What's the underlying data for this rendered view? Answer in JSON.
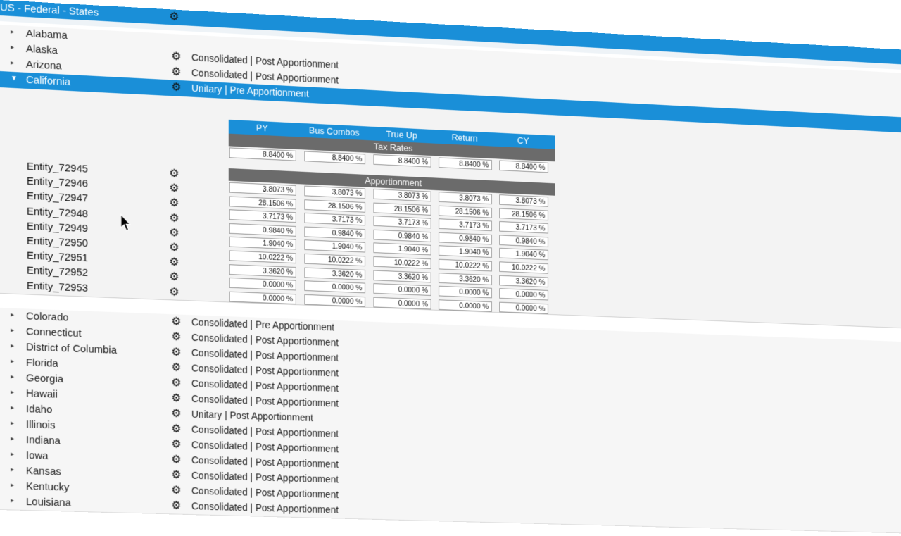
{
  "header": {
    "title": "US - Federal - States"
  },
  "states_before": [
    {
      "name": "Alabama",
      "mode": ""
    },
    {
      "name": "Alaska",
      "mode": "Consolidated | Post Apportionment"
    },
    {
      "name": "Arizona",
      "mode": "Consolidated | Post Apportionment"
    }
  ],
  "selected_state": {
    "name": "California",
    "mode": "Unitary | Pre Apportionment",
    "extra_mode": "Unitary | Post Apportionment"
  },
  "columns": [
    "PY",
    "Bus Combos",
    "True Up",
    "Return",
    "CY"
  ],
  "sections": {
    "tax_rates": "Tax Rates",
    "apportionment": "Apportionment"
  },
  "tax_rates": [
    "8.8400 %",
    "8.8400 %",
    "8.8400 %",
    "8.8400 %",
    "8.8400 %"
  ],
  "entities": [
    {
      "name": "Entity_72945",
      "values": []
    },
    {
      "name": "Entity_72946",
      "values": [
        "3.8073 %",
        "3.8073 %",
        "3.8073 %",
        "3.8073 %",
        "3.8073 %"
      ]
    },
    {
      "name": "Entity_72947",
      "values": [
        "28.1506 %",
        "28.1506 %",
        "28.1506 %",
        "28.1506 %",
        "28.1506 %"
      ]
    },
    {
      "name": "Entity_72948",
      "values": [
        "3.7173 %",
        "3.7173 %",
        "3.7173 %",
        "3.7173 %",
        "3.7173 %"
      ]
    },
    {
      "name": "Entity_72949",
      "values": [
        "0.9840 %",
        "0.9840 %",
        "0.9840 %",
        "0.9840 %",
        "0.9840 %"
      ]
    },
    {
      "name": "Entity_72950",
      "values": [
        "1.9040 %",
        "1.9040 %",
        "1.9040 %",
        "1.9040 %",
        "1.9040 %"
      ]
    },
    {
      "name": "Entity_72951",
      "values": [
        "10.0222 %",
        "10.0222 %",
        "10.0222 %",
        "10.0222 %",
        "10.0222 %"
      ]
    },
    {
      "name": "Entity_72952",
      "values": [
        "3.3620 %",
        "3.3620 %",
        "3.3620 %",
        "3.3620 %",
        "3.3620 %"
      ]
    },
    {
      "name": "Entity_72953",
      "values": [
        "0.0000 %",
        "0.0000 %",
        "0.0000 %",
        "0.0000 %",
        "0.0000 %"
      ]
    }
  ],
  "extra_row": [
    "0.0000 %",
    "0.0000 %",
    "0.0000 %",
    "0.0000 %",
    "0.0000 %"
  ],
  "states_after": [
    {
      "name": "Colorado",
      "mode": "Consolidated | Pre Apportionment"
    },
    {
      "name": "Connecticut",
      "mode": "Consolidated | Post Apportionment"
    },
    {
      "name": "District of Columbia",
      "mode": "Consolidated | Post Apportionment"
    },
    {
      "name": "Florida",
      "mode": "Consolidated | Post Apportionment"
    },
    {
      "name": "Georgia",
      "mode": "Consolidated | Post Apportionment"
    },
    {
      "name": "Hawaii",
      "mode": "Consolidated | Post Apportionment"
    },
    {
      "name": "Idaho",
      "mode": "Unitary | Post Apportionment"
    },
    {
      "name": "Illinois",
      "mode": "Consolidated | Post Apportionment"
    },
    {
      "name": "Indiana",
      "mode": "Consolidated | Post Apportionment"
    },
    {
      "name": "Iowa",
      "mode": "Consolidated | Post Apportionment"
    },
    {
      "name": "Kansas",
      "mode": "Consolidated | Post Apportionment"
    },
    {
      "name": "Kentucky",
      "mode": "Consolidated | Post Apportionment"
    },
    {
      "name": "Louisiana",
      "mode": "Consolidated | Post Apportionment"
    }
  ],
  "icons": {
    "expand": "chevron-right-icon",
    "collapse": "chevron-down-icon",
    "settings": "gear-icon",
    "pointer": "mouse-cursor-icon"
  },
  "colors": {
    "accent": "#1a8fd8",
    "band": "#6b6b6b"
  }
}
